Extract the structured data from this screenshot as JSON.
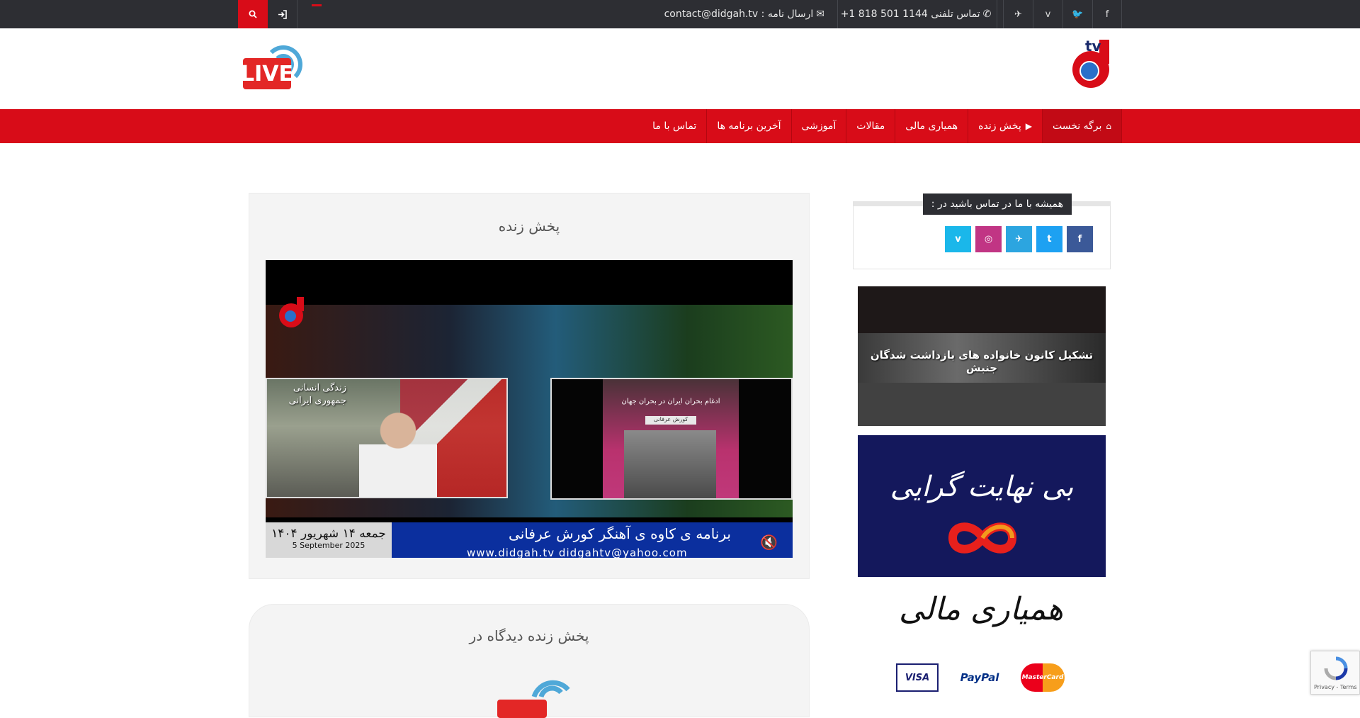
{
  "topbar": {
    "search_icon": "search-icon",
    "login_icon": "sign-in-icon",
    "email_label": "ارسال نامه : contact@didgah.tv",
    "phone_label": "تماس تلفنی 1144 501 818 1+",
    "social_icons": [
      "facebook-icon",
      "twitter-icon",
      "vimeo-icon",
      "telegram-icon"
    ],
    "social_glyphs": [
      "f",
      "🐦",
      "v",
      "✈"
    ]
  },
  "header": {
    "live_logo_text": "LIVE",
    "site_logo_text": "tv"
  },
  "nav": {
    "items": [
      {
        "label": "برگه نخست",
        "icon": "home-icon",
        "glyph": "⌂"
      },
      {
        "label": "پخش زنده",
        "icon": "play-icon",
        "glyph": "▶"
      },
      {
        "label": "همیاری مالی"
      },
      {
        "label": "مقالات"
      },
      {
        "label": "آموزشی"
      },
      {
        "label": "آخرین برنامه ها"
      },
      {
        "label": "تماس با ما"
      }
    ]
  },
  "main": {
    "live_panel_title": "پخش زنده",
    "player": {
      "left_caption": "زندگی انسانی جمهوری ایرانی",
      "poster_title": "ادغام بحران ایران در بحران جهان",
      "poster_subtitle": "کورش عرفانی",
      "ticker_date": "جمعه ۱۴ شهریور ۱۴۰۴",
      "ticker_date_en": "5 September 2025",
      "ticker_program": "برنامه ی کاوه ی آهنگر   کورش عرفانی",
      "ticker_web": "www.didgah.tv    didgahtv@yahoo.com",
      "mute_icon": "mute-icon",
      "mute_glyph": "🔇"
    },
    "second_panel_title": "پخش زنده دیدگاه در"
  },
  "sidebar": {
    "widget_title": "همیشه با ما در تماس باشید در :",
    "social": [
      {
        "icon": "facebook-icon",
        "glyph": "f",
        "color": "#3b5998"
      },
      {
        "icon": "twitter-icon",
        "glyph": "t",
        "color": "#1da1f2"
      },
      {
        "icon": "telegram-icon",
        "glyph": "✈",
        "color": "#2ca5e0"
      },
      {
        "icon": "instagram-icon",
        "glyph": "◎",
        "color": "#c13584"
      },
      {
        "icon": "vimeo-icon",
        "glyph": "v",
        "color": "#1ab7ea"
      }
    ],
    "banner1_text": "تشکیل کانون خانواده های بازداشت شدگان جنبش",
    "banner2_text": "بی نهایت گرایی",
    "banner3_text": "همیاری مالی",
    "cards": [
      "VISA",
      "PayPal",
      "MasterCard"
    ]
  },
  "recaptcha": {
    "links": "Privacy - Terms"
  }
}
